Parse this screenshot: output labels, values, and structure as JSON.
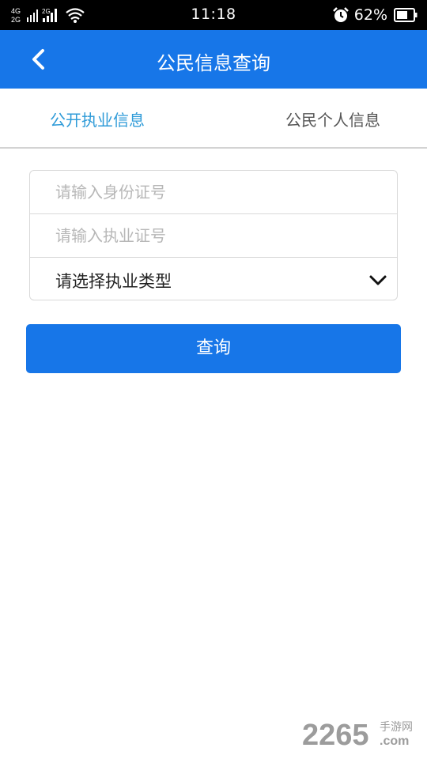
{
  "status_bar": {
    "network_labels": [
      "4G",
      "2G",
      "2G"
    ],
    "time": "11:18",
    "battery_percent": "62%",
    "icons": [
      "signal-icon",
      "wifi-icon",
      "alarm-icon",
      "battery-icon"
    ]
  },
  "header": {
    "title": "公民信息查询",
    "back_icon": "chevron-left-icon"
  },
  "tabs": [
    {
      "label": "公开执业信息",
      "active": true
    },
    {
      "label": "公民个人信息",
      "active": false
    }
  ],
  "form": {
    "id_number": {
      "value": "",
      "placeholder": "请输入身份证号"
    },
    "license_number": {
      "value": "",
      "placeholder": "请输入执业证号"
    },
    "practice_type": {
      "selected": "请选择执业类型",
      "icon": "chevron-down-icon"
    }
  },
  "actions": {
    "query_label": "查询"
  },
  "watermark": {
    "text": "2265",
    "suffix": "手游网",
    "domain": ".com"
  },
  "colors": {
    "primary": "#1776e8",
    "tab_active": "#2f9bd8",
    "tab_inactive": "#555555",
    "border": "#d9d9d9",
    "placeholder": "#b7b7b7"
  }
}
